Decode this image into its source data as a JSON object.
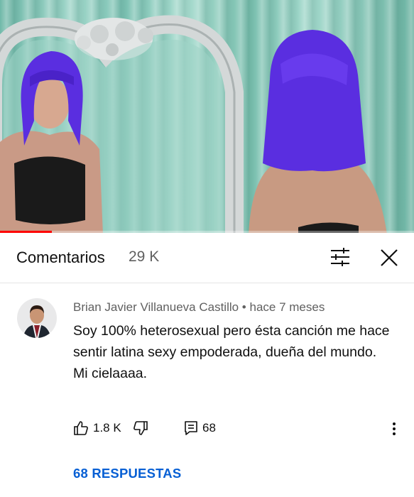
{
  "video": {
    "progress_fraction": 0.125,
    "colors": {
      "progress": "#ff0000",
      "hair": "#5a2ee0",
      "curtain": "#8fcfc0"
    }
  },
  "header": {
    "title": "Comentarios",
    "count": "29 K",
    "filter_icon": "filter-sliders-icon",
    "close_icon": "close-icon"
  },
  "comment": {
    "author": "Brian Javier Villanueva Castillo",
    "separator": " • ",
    "time": "hace 7 meses",
    "lines": [
      "Soy 100% heterosexual pero ésta canción me hace sentir latina sexy  empoderada, dueña del mundo.",
      "Mi cielaaaa."
    ],
    "likes": "1.8 K",
    "replies_count": "68",
    "like_icon": "thumbs-up-icon",
    "dislike_icon": "thumbs-down-icon",
    "reply_icon": "reply-comment-icon",
    "more_icon": "more-vertical-icon"
  },
  "replies_link": "68 RESPUESTAS",
  "colors": {
    "link": "#065fd4",
    "secondary_text": "#606060"
  }
}
